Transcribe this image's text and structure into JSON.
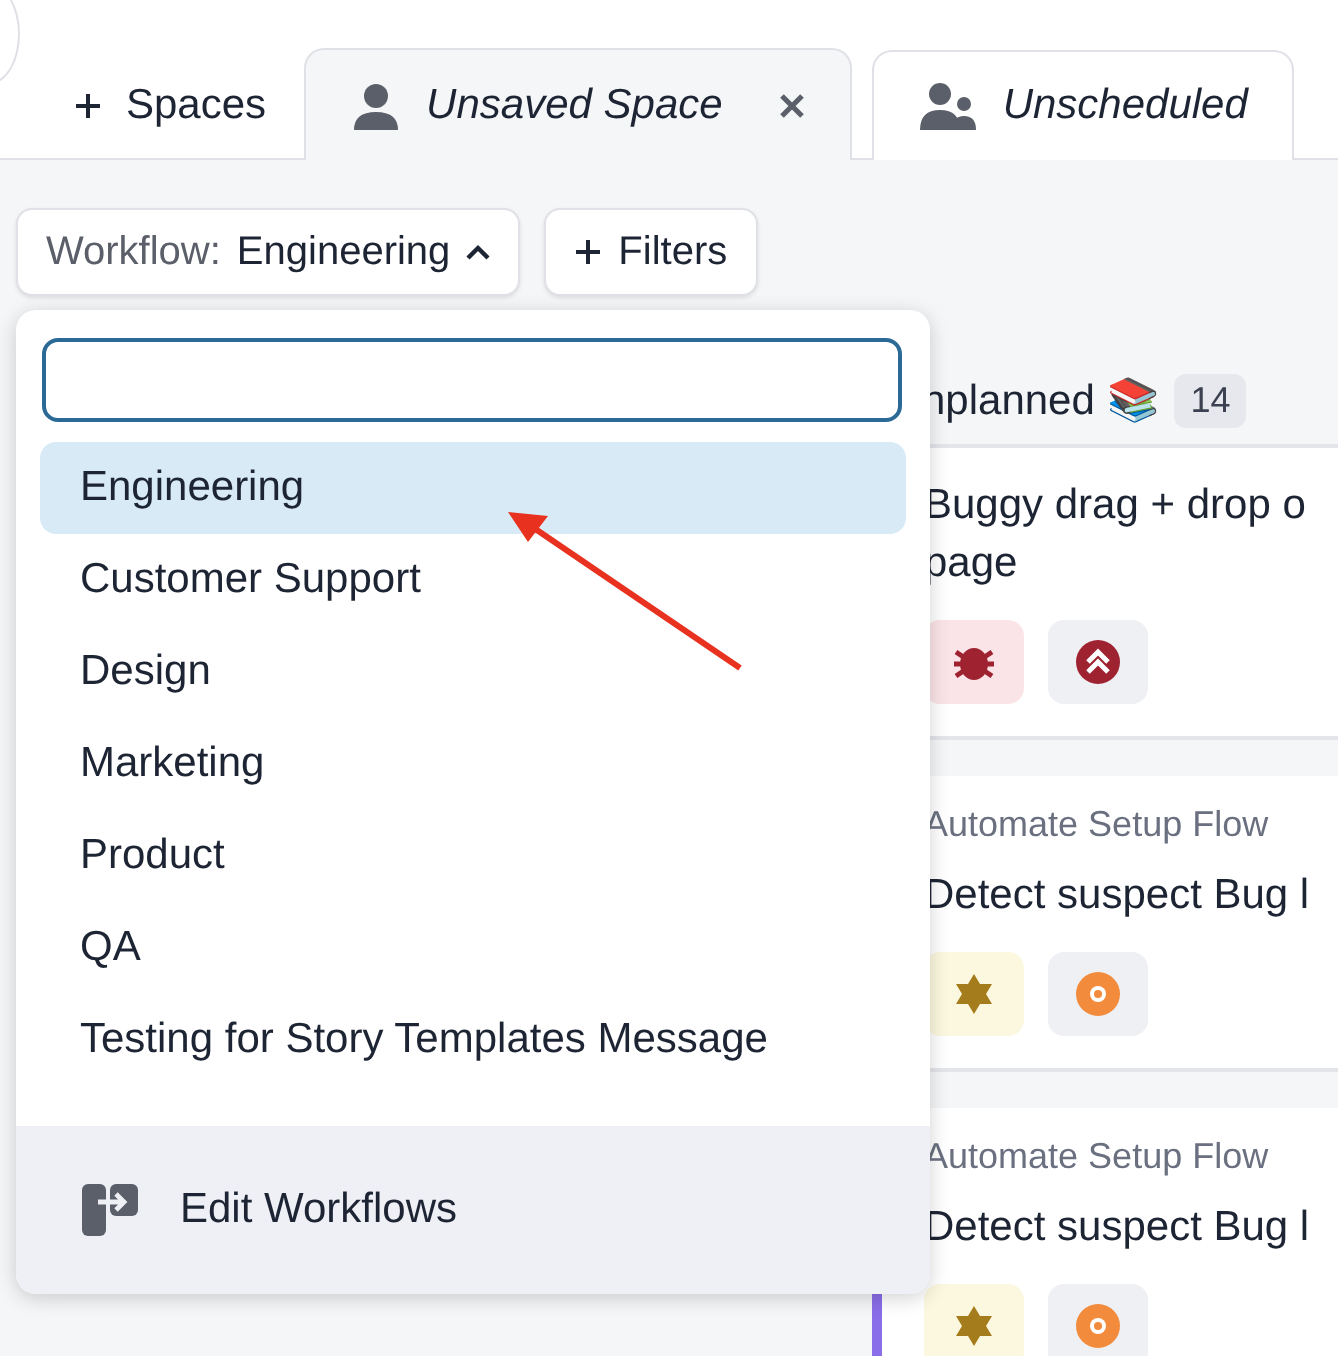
{
  "add_space": "Spaces",
  "tabs": [
    {
      "label": "Unsaved Space",
      "kind": "person",
      "selected": true,
      "closable": true
    },
    {
      "label": "Unscheduled",
      "kind": "group",
      "selected": false,
      "closable": false
    }
  ],
  "toolbar": {
    "workflow_label": "Workflow:",
    "workflow_value": "Engineering",
    "expanded": true,
    "filters": "Filters"
  },
  "dropdown": {
    "items": [
      {
        "label": "Engineering",
        "selected": true
      },
      {
        "label": "Customer Support",
        "selected": false
      },
      {
        "label": "Design",
        "selected": false
      },
      {
        "label": "Marketing",
        "selected": false
      },
      {
        "label": "Product",
        "selected": false
      },
      {
        "label": "QA",
        "selected": false
      },
      {
        "label": "Testing for Story Templates Message",
        "selected": false
      }
    ],
    "footer": "Edit Workflows"
  },
  "column": {
    "title": "nplanned",
    "emoji": "📚",
    "count": "14",
    "cards": [
      {
        "title_lines": [
          "Buggy drag + drop o",
          "page"
        ],
        "chips": [
          {
            "kind": "bug"
          },
          {
            "kind": "high"
          }
        ],
        "accent": false
      },
      {
        "epic": "Automate Setup Flow",
        "title_lines": [
          "Detect suspect Bug l"
        ],
        "chips": [
          {
            "kind": "feature"
          },
          {
            "kind": "medium"
          }
        ],
        "accent": false
      },
      {
        "epic": "Automate Setup Flow",
        "title_lines": [
          "Detect suspect Bug l"
        ],
        "chips": [
          {
            "kind": "feature"
          },
          {
            "kind": "medium"
          }
        ],
        "accent": true
      }
    ]
  }
}
